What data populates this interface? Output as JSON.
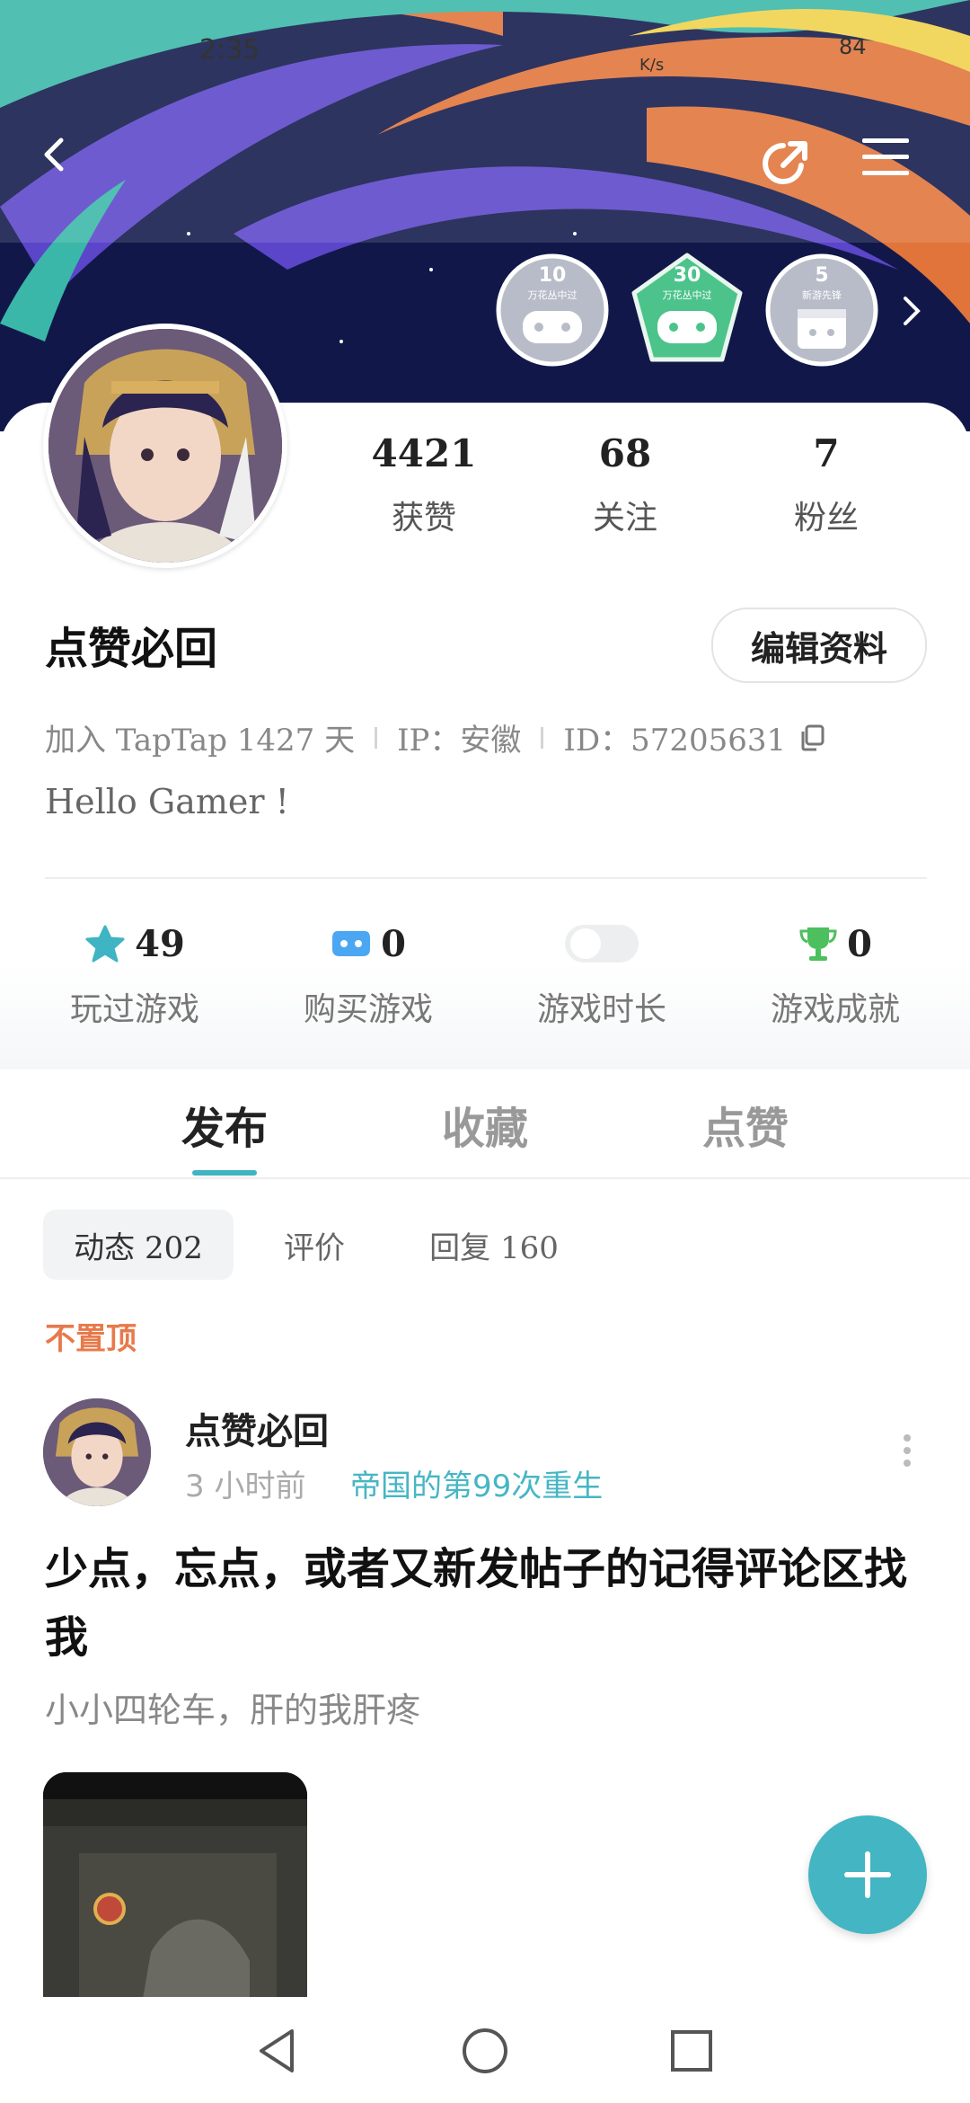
{
  "status_bar": {
    "time": "2:35",
    "speed": "K/s",
    "battery": "84"
  },
  "profile": {
    "username": "点赞必回",
    "edit_label": "编辑资料",
    "stats": [
      {
        "value": "4421",
        "label": "获赞"
      },
      {
        "value": "68",
        "label": "关注"
      },
      {
        "value": "7",
        "label": "粉丝"
      }
    ],
    "join_text": "加入 TapTap 1427 天",
    "ip_text": "IP：安徽",
    "id_text": "ID：57205631",
    "bio": "Hello Gamer !"
  },
  "badges": [
    {
      "num": "10",
      "sub": "万花丛中过"
    },
    {
      "num": "30",
      "sub": "万花丛中过"
    },
    {
      "num": "5",
      "sub": "新游先锋"
    }
  ],
  "game_stats": [
    {
      "value": "49",
      "label": "玩过游戏",
      "icon": "star-icon"
    },
    {
      "value": "0",
      "label": "购买游戏",
      "icon": "gamepad-icon"
    },
    {
      "value": "",
      "label": "游戏时长",
      "icon": "toggle-switch"
    },
    {
      "value": "0",
      "label": "游戏成就",
      "icon": "trophy-icon"
    }
  ],
  "tabs": {
    "publish": "发布",
    "favorites": "收藏",
    "likes": "点赞"
  },
  "chips": {
    "moments": "动态 202",
    "reviews": "评价",
    "replies": "回复 160"
  },
  "pinned_label": "不置顶",
  "post": {
    "author": "点赞必回",
    "time": "3 小时前",
    "group": "帝国的第99次重生",
    "title": "少点，忘点，或者又新发帖子的记得评论区找我",
    "body": "小小四轮车，肝的我肝疼"
  },
  "colors": {
    "accent": "#43b5c3",
    "pinned": "#e8794a",
    "badge_active": "#4cc38a"
  }
}
